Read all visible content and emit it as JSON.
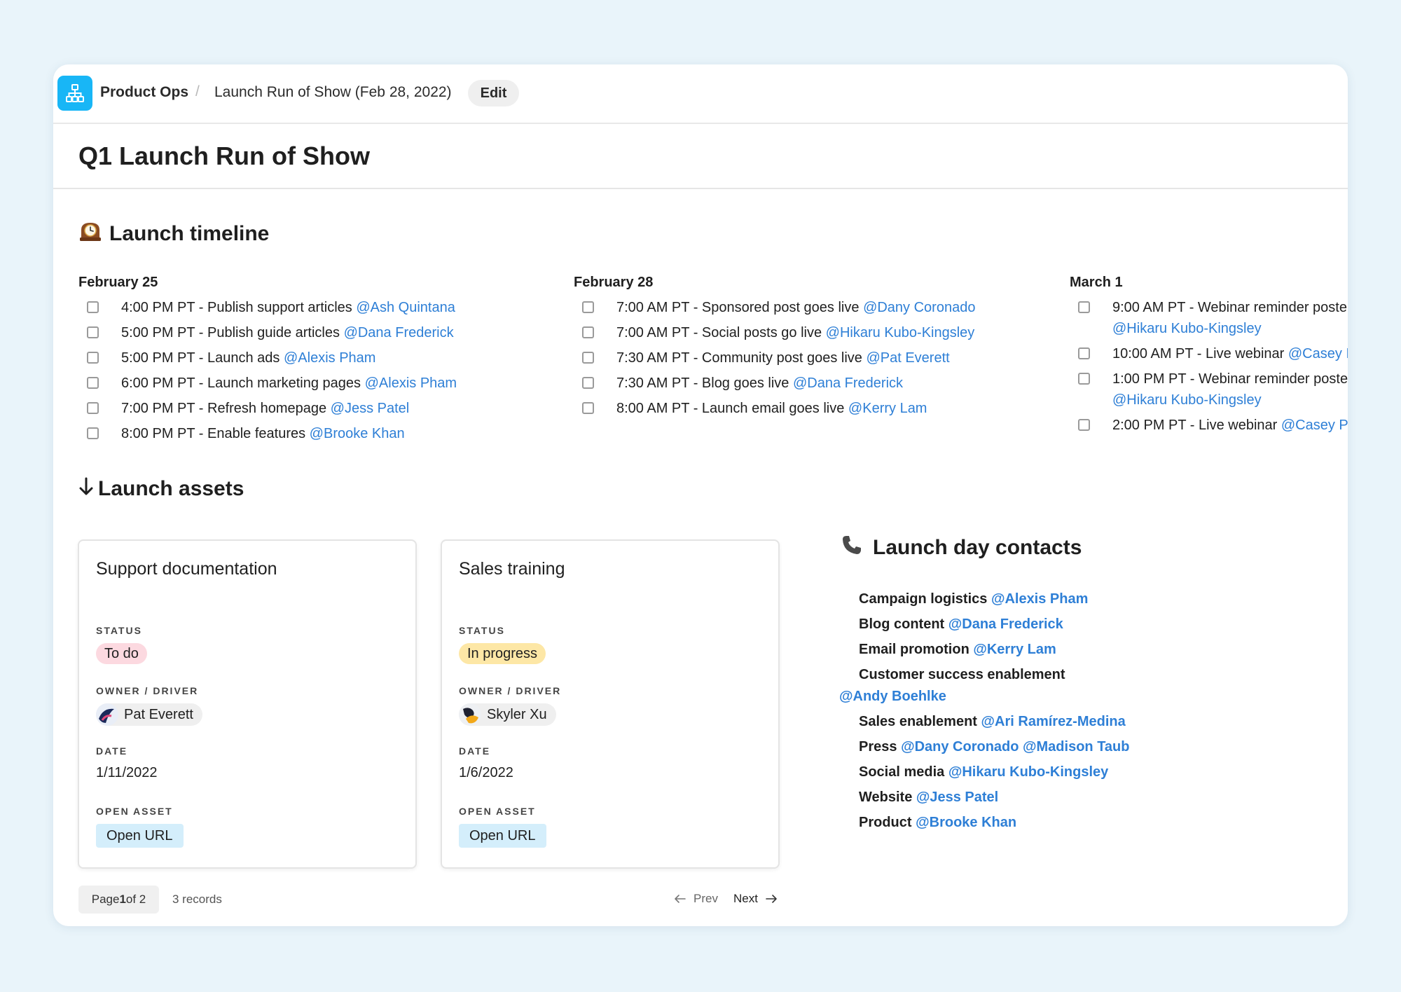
{
  "breadcrumb": {
    "workspace": "Product Ops",
    "separator": "/",
    "page": "Launch Run of Show (Feb 28, 2022)",
    "edit_label": "Edit"
  },
  "page_title": "Q1 Launch Run of Show",
  "timeline": {
    "heading": "Launch timeline",
    "icon": "mantel-clock-icon",
    "columns": [
      {
        "date": "February 25",
        "tasks": [
          {
            "text": "4:00 PM PT - Publish support articles ",
            "mention": "@Ash Quintana"
          },
          {
            "text": "5:00 PM PT - Publish guide articles ",
            "mention": "@Dana Frederick"
          },
          {
            "text": "5:00 PM PT - Launch ads ",
            "mention": "@Alexis Pham"
          },
          {
            "text": "6:00 PM PT - Launch marketing pages ",
            "mention": "@Alexis Pham"
          },
          {
            "text": "7:00 PM PT - Refresh homepage ",
            "mention": "@Jess Patel"
          },
          {
            "text": "8:00 PM PT - Enable features ",
            "mention": "@Brooke Khan"
          }
        ]
      },
      {
        "date": "February 28",
        "tasks": [
          {
            "text": "7:00 AM PT - Sponsored post goes live ",
            "mention": "@Dany Coronado"
          },
          {
            "text": "7:00 AM PT - Social posts go live ",
            "mention": "@Hikaru Kubo-Kingsley"
          },
          {
            "text": "7:30 AM PT - Community post goes live ",
            "mention": "@Pat Everett"
          },
          {
            "text": "7:30 AM PT - Blog goes live ",
            "mention": "@Dana Frederick"
          },
          {
            "text": "8:00 AM PT - Launch email goes live ",
            "mention": "@Kerry Lam"
          }
        ]
      },
      {
        "date": "March 1",
        "tasks": [
          {
            "text": "9:00 AM PT - Webinar reminder poste",
            "mention": "@Hikaru Kubo-Kingsley"
          },
          {
            "text": "10:00 AM PT - Live webinar ",
            "mention": "@Casey I"
          },
          {
            "text": "1:00 PM PT - Webinar reminder poste",
            "mention": "@Hikaru Kubo-Kingsley"
          },
          {
            "text": "2:00 PM PT - Live webinar ",
            "mention": "@Casey Pa"
          }
        ]
      }
    ]
  },
  "assets": {
    "heading": "Launch assets",
    "icon": "arrow-down-icon",
    "labels": {
      "status": "STATUS",
      "owner": "OWNER / DRIVER",
      "date": "DATE",
      "open_asset": "OPEN ASSET"
    },
    "cards": [
      {
        "title": "Support documentation",
        "status": "To do",
        "status_color": "#fcd9e0",
        "owner": "Pat Everett",
        "date": "1/11/2022",
        "url_label": "Open URL"
      },
      {
        "title": "Sales training",
        "status": "In progress",
        "status_color": "#fde7a6",
        "owner": "Skyler Xu",
        "date": "1/6/2022",
        "url_label": "Open URL"
      }
    ],
    "pager": {
      "page_prefix": "Page ",
      "page_current": "1",
      "page_suffix": " of 2",
      "records": "3 records",
      "prev": "Prev",
      "next": "Next"
    }
  },
  "contacts": {
    "heading": "Launch day contacts",
    "icon": "telephone-icon",
    "items": [
      {
        "role": "Campaign logistics ",
        "people": "@Alexis Pham"
      },
      {
        "role": "Blog content ",
        "people": "@Dana Frederick"
      },
      {
        "role": "Email promotion ",
        "people": "@Kerry Lam"
      },
      {
        "role": "Customer success enablement",
        "people": "@Andy Boehlke"
      },
      {
        "role": "Sales enablement ",
        "people": "@Ari Ramírez-Medina"
      },
      {
        "role": "Press ",
        "people": "@Dany Coronado @Madison Taub"
      },
      {
        "role": "Social media ",
        "people": "@Hikaru Kubo-Kingsley"
      },
      {
        "role": "Website ",
        "people": "@Jess Patel"
      },
      {
        "role": "Product ",
        "people": "@Brooke Khan"
      }
    ]
  },
  "colors": {
    "accent": "#18b6f6",
    "mention": "#2e7fd6",
    "background": "#e9f4fa"
  }
}
